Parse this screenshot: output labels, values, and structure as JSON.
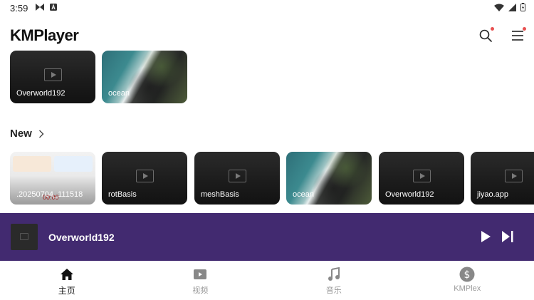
{
  "status": {
    "time": "3:59"
  },
  "header": {
    "app_name": "KMPlayer"
  },
  "top_row": [
    {
      "title": "Overworld192",
      "kind": "video"
    },
    {
      "title": "ocean",
      "kind": "ocean"
    }
  ],
  "new_section": {
    "title": "New",
    "items": [
      {
        "title": ".20250704_111518",
        "kind": "screenshot",
        "overlay_time": "00:00"
      },
      {
        "title": "rotBasis",
        "kind": "video"
      },
      {
        "title": "meshBasis",
        "kind": "video"
      },
      {
        "title": "ocean",
        "kind": "ocean"
      },
      {
        "title": "Overworld192",
        "kind": "video"
      },
      {
        "title": "jiyao.app",
        "kind": "video"
      }
    ]
  },
  "mini_player": {
    "title": "Overworld192"
  },
  "bottom_nav": {
    "items": [
      {
        "label": "主页",
        "icon": "home-icon",
        "active": true
      },
      {
        "label": "视频",
        "icon": "video-icon",
        "active": false
      },
      {
        "label": "音乐",
        "icon": "music-icon",
        "active": false
      },
      {
        "label": "KMPlex",
        "icon": "dollar-icon",
        "active": false
      }
    ]
  },
  "colors": {
    "mini_player_bg": "#422a70",
    "notification_dot": "#e85050"
  }
}
